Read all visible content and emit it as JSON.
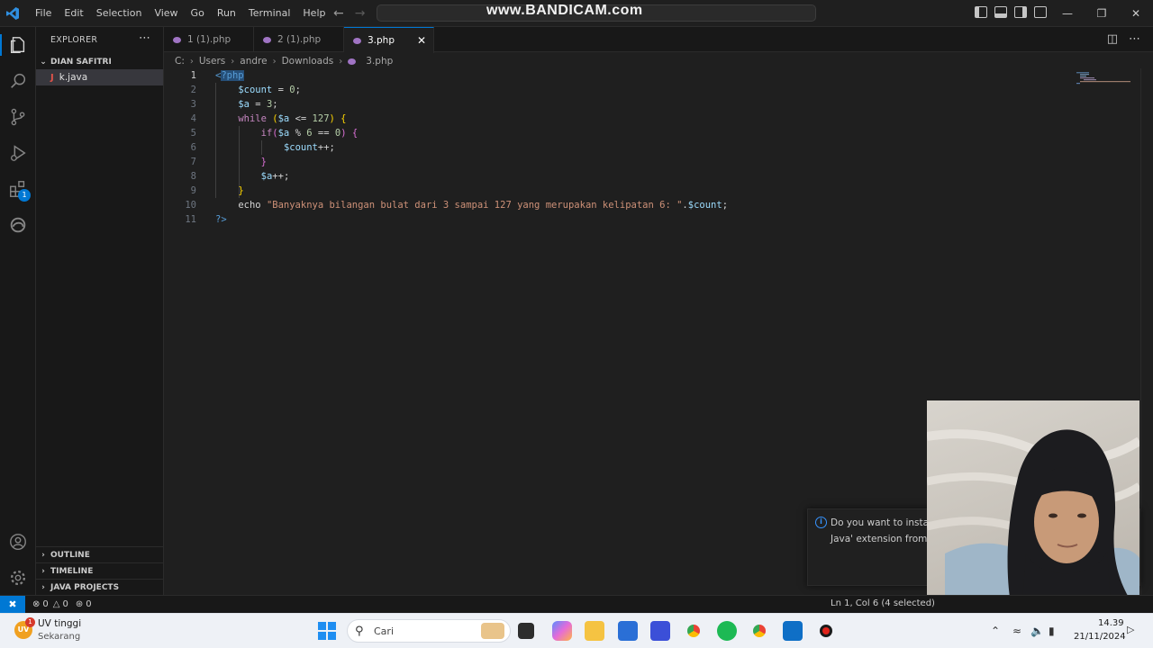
{
  "watermark": "www.BANDICAM.com",
  "menu": [
    "File",
    "Edit",
    "Selection",
    "View",
    "Go",
    "Run",
    "Terminal",
    "Help"
  ],
  "sidebar": {
    "title": "EXPLORER",
    "folder": "DIAN SAFITRI",
    "files": [
      {
        "name": "k.java",
        "icon": "java-icon"
      }
    ],
    "sections": [
      "OUTLINE",
      "TIMELINE",
      "JAVA PROJECTS"
    ]
  },
  "tabs": [
    {
      "label": "1 (1).php",
      "active": false
    },
    {
      "label": "2 (1).php",
      "active": false
    },
    {
      "label": "3.php",
      "active": true
    }
  ],
  "breadcrumb": [
    "C:",
    "Users",
    "andre",
    "Downloads",
    "3.php"
  ],
  "code": {
    "lines": [
      {
        "n": "1",
        "text": "<?php"
      },
      {
        "n": "2",
        "text": "    $count = 0;"
      },
      {
        "n": "3",
        "text": "    $a = 3;"
      },
      {
        "n": "4",
        "text": "    while ($a <= 127) {"
      },
      {
        "n": "5",
        "text": "        if($a % 6 == 0) {"
      },
      {
        "n": "6",
        "text": "            $count++;"
      },
      {
        "n": "7",
        "text": "        }"
      },
      {
        "n": "8",
        "text": "        $a++;"
      },
      {
        "n": "9",
        "text": "    }"
      },
      {
        "n": "10",
        "text": "    echo \"Banyaknya bilangan bulat dari 3 sampai 127 yang merupakan kelipatan 6: \".$count;"
      },
      {
        "n": "11",
        "text": "?>"
      }
    ],
    "current_line": 1,
    "selection": "?php"
  },
  "notification": {
    "line1": "Do you want to install",
    "line2": "Java' extension from M"
  },
  "status": {
    "errors": "0",
    "warnings": "0",
    "ports": "0",
    "cursor": "Ln 1, Col 6 (4 selected)"
  },
  "taskbar": {
    "weather_title": "UV tinggi",
    "weather_sub": "Sekarang",
    "weather_badge": "1",
    "search_placeholder": "Cari",
    "time": "14.39",
    "date": "21/11/2024"
  },
  "colors": {
    "accent": "#0078d4",
    "editor_bg": "#1f1f1f",
    "keyword": "#c586c0",
    "variable": "#9cdcfe",
    "string": "#ce9178",
    "number": "#b5cea8"
  }
}
